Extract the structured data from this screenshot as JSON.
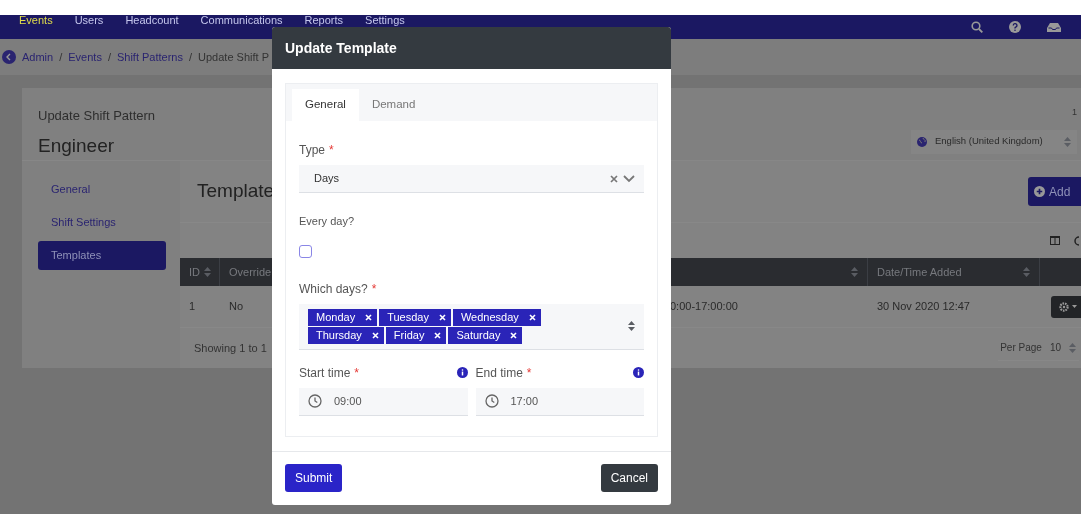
{
  "nav": {
    "items": [
      {
        "label": "Events",
        "selected": true
      },
      {
        "label": "Users",
        "selected": false
      },
      {
        "label": "Headcount",
        "selected": false
      },
      {
        "label": "Communications",
        "selected": false
      },
      {
        "label": "Reports",
        "selected": false
      },
      {
        "label": "Settings",
        "selected": false
      }
    ]
  },
  "breadcrumb": {
    "separator": "/",
    "items": [
      "Admin",
      "Events",
      "Shift Patterns",
      "Update Shift P"
    ]
  },
  "header": {
    "subtitle": "Update Shift Pattern",
    "title": "Engineer",
    "count": "1",
    "language": "English (United Kingdom)"
  },
  "menu": [
    {
      "label": "General",
      "selected": false
    },
    {
      "label": "Shift Settings",
      "selected": false
    },
    {
      "label": "Templates",
      "selected": true
    }
  ],
  "panel": {
    "title": "Template",
    "add_button": "Add",
    "columns": [
      "ID",
      "Override",
      "",
      "Date/Time Added"
    ],
    "rows": [
      [
        "1",
        "No",
        "0:00-17:00:00",
        "30 Nov 2020 12:47"
      ]
    ],
    "footer": "Showing 1 to 1",
    "per_page_label": "Per Page",
    "per_page": "10"
  },
  "modal": {
    "title": "Update Template",
    "tabs": [
      {
        "label": "General",
        "selected": true
      },
      {
        "label": "Demand",
        "selected": false
      }
    ],
    "type": {
      "label": "Type",
      "mark": "*",
      "value": "Days"
    },
    "every_day": {
      "label": "Every day?",
      "checked": false
    },
    "which_days": {
      "label": "Which days?",
      "mark": "*",
      "tags": [
        "Monday",
        "Tuesday",
        "Wednesday",
        "Thursday",
        "Friday",
        "Saturday"
      ]
    },
    "start_time": {
      "label": "Start time",
      "mark": "*",
      "value": "09:00"
    },
    "end_time": {
      "label": "End time",
      "mark": "*",
      "value": "17:00"
    },
    "submit": "Submit",
    "cancel": "Cancel"
  }
}
